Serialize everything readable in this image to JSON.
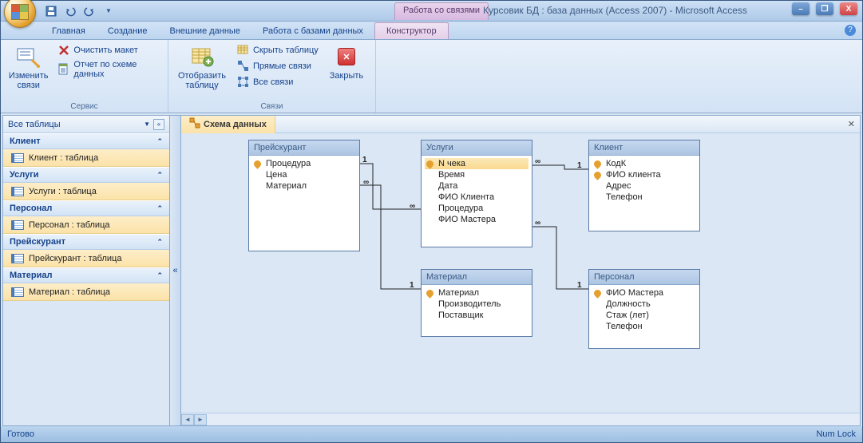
{
  "titlebar": {
    "context_tab": "Работа со связями",
    "title": "Курсовик БД : база данных (Access 2007) - Microsoft Access"
  },
  "tabs": {
    "items": [
      "Главная",
      "Создание",
      "Внешние данные",
      "Работа с базами данных",
      "Конструктор"
    ],
    "active": 4
  },
  "ribbon": {
    "group1": {
      "label": "Сервис",
      "big_btn": "Изменить\nсвязи",
      "btn1": "Очистить макет",
      "btn2": "Отчет по схеме данных"
    },
    "group2": {
      "label": "Связи",
      "big_btn": "Отобразить\nтаблицу",
      "btn1": "Скрыть таблицу",
      "btn2": "Прямые связи",
      "btn3": "Все связи",
      "close": "Закрыть"
    }
  },
  "nav": {
    "header": "Все таблицы",
    "groups": [
      {
        "name": "Клиент",
        "item": "Клиент : таблица"
      },
      {
        "name": "Услуги",
        "item": "Услуги : таблица"
      },
      {
        "name": "Персонал",
        "item": "Персонал : таблица"
      },
      {
        "name": "Прейскурант",
        "item": "Прейскурант : таблица"
      },
      {
        "name": "Материал",
        "item": "Материал : таблица"
      }
    ]
  },
  "doc_tab": "Схема данных",
  "tables": {
    "t1": {
      "title": "Прейскурант",
      "fields": [
        {
          "n": "Процедура",
          "pk": true
        },
        {
          "n": "Цена"
        },
        {
          "n": "Материал"
        }
      ]
    },
    "t2": {
      "title": "Услуги",
      "fields": [
        {
          "n": "N чека",
          "pk": true,
          "sel": true
        },
        {
          "n": "Время"
        },
        {
          "n": "Дата"
        },
        {
          "n": "ФИО Клиента"
        },
        {
          "n": "Процедура"
        },
        {
          "n": "ФИО Мастера"
        }
      ]
    },
    "t3": {
      "title": "Клиент",
      "fields": [
        {
          "n": "КодК",
          "pk": true
        },
        {
          "n": "ФИО клиента",
          "pk": true
        },
        {
          "n": "Адрес"
        },
        {
          "n": "Телефон"
        }
      ]
    },
    "t4": {
      "title": "Материал",
      "fields": [
        {
          "n": "Материал",
          "pk": true
        },
        {
          "n": "Производитель"
        },
        {
          "n": "Поставщик"
        }
      ]
    },
    "t5": {
      "title": "Персонал",
      "fields": [
        {
          "n": "ФИО Мастера",
          "pk": true
        },
        {
          "n": "Должность"
        },
        {
          "n": "Стаж (лет)"
        },
        {
          "n": "Телефон"
        }
      ]
    }
  },
  "rel_labels": {
    "one": "1",
    "many": "∞"
  },
  "status": {
    "left": "Готово",
    "right": "Num Lock"
  }
}
